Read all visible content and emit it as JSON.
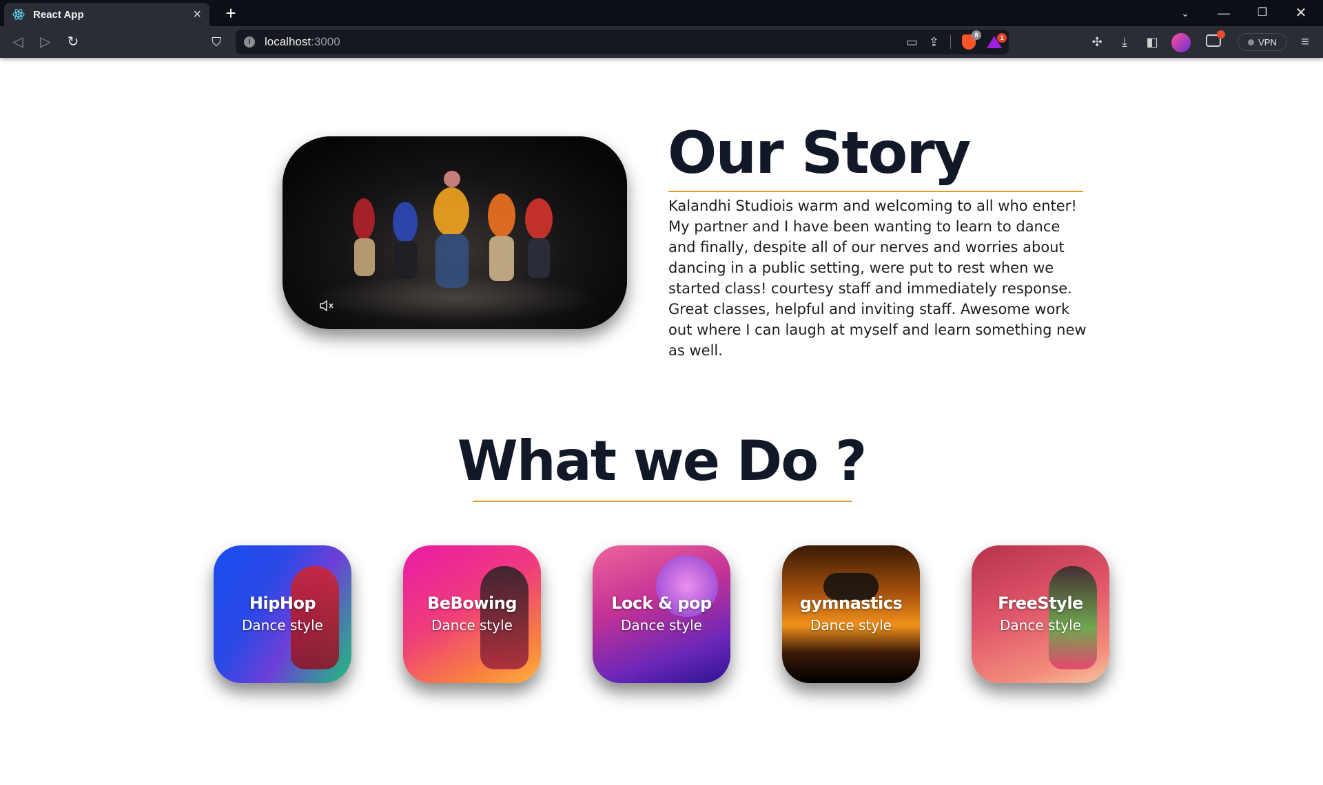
{
  "browser": {
    "tab_title": "React App",
    "url_host": "localhost",
    "url_port": ":3000",
    "vpn_label": "VPN",
    "brave_badge": "8",
    "rewards_badge": "1"
  },
  "story": {
    "title": "Our Story",
    "text": "Kalandhi Studiois warm and welcoming to all who enter! My partner and I have been wanting to learn to dance and finally, despite all of our nerves and worries about dancing in a public setting, were put to rest when we started class! courtesy staff and immediately response. Great classes, helpful and inviting staff. Awesome work out where I can laugh at myself and learn something new as well."
  },
  "what_we_do": {
    "title": "What we Do ?",
    "cards": [
      {
        "name": "HipHop",
        "subtitle": "Dance style"
      },
      {
        "name": "BeBowing",
        "subtitle": "Dance style"
      },
      {
        "name": "Lock & pop",
        "subtitle": "Dance style"
      },
      {
        "name": "gymnastics",
        "subtitle": "Dance style"
      },
      {
        "name": "FreeStyle",
        "subtitle": "Dance style"
      }
    ]
  },
  "colors": {
    "accent_underline": "#e39a2d",
    "heading": "#111827",
    "chrome_dark": "#0d0f17",
    "chrome_toolbar": "#2b2d36"
  }
}
